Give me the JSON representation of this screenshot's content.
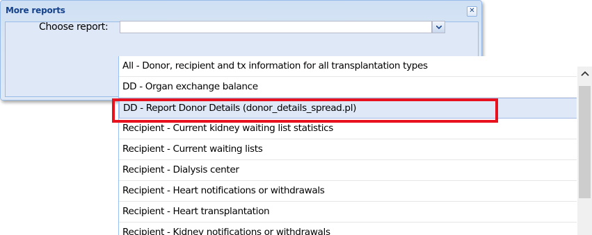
{
  "dialog": {
    "title": "More reports",
    "close_glyph": "✕",
    "field_label": "Choose report:",
    "combo_value": ""
  },
  "dropdown": {
    "selected_index": 2,
    "options": [
      "All - Donor, recipient and tx information for all transplantation types",
      "DD - Organ exchange balance",
      "DD - Report Donor Details (donor_details_spread.pl)",
      "Recipient - Current kidney waiting list statistics",
      "Recipient - Current waiting lists",
      "Recipient - Dialysis center",
      "Recipient - Heart notifications or withdrawals",
      "Recipient - Heart transplantation",
      "Recipient - Kidney notifications or withdrawals"
    ]
  },
  "colors": {
    "accent_title": "#15428b",
    "highlight": "#e8121f",
    "selected_bg": "#dfe8f6"
  },
  "icons": {
    "close": "close-icon",
    "combo_trigger": "chevron-down-icon",
    "scroll_up": "chevron-up-icon"
  }
}
